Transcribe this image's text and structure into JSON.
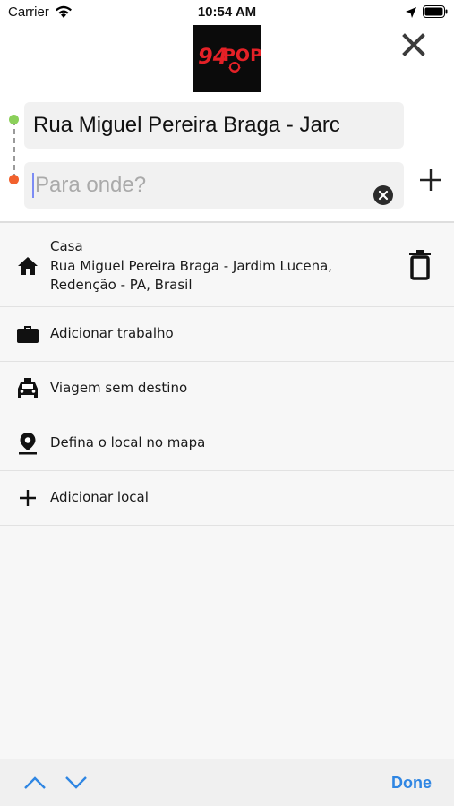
{
  "status_bar": {
    "carrier": "Carrier",
    "time": "10:54 AM"
  },
  "header": {
    "logo_text": "94POP",
    "origin_value": "Rua Miguel Pereira Braga - Jarc",
    "destination_placeholder": "Para onde?",
    "origin_dot_color": "#8bd05a",
    "destination_dot_color": "#f2612d"
  },
  "list": {
    "home": {
      "title": "Casa",
      "address": "Rua Miguel Pereira Braga - Jardim Lucena, Redenção - PA, Brasil",
      "icon": "home-icon"
    },
    "items": [
      {
        "label": "Adicionar trabalho",
        "icon": "briefcase-icon"
      },
      {
        "label": "Viagem sem destino",
        "icon": "taxi-icon"
      },
      {
        "label": "Defina o local no mapa",
        "icon": "map-pin-icon"
      },
      {
        "label": "Adicionar local",
        "icon": "plus-icon"
      }
    ]
  },
  "keyboard_bar": {
    "done_label": "Done",
    "accent_color": "#2f86e3"
  }
}
